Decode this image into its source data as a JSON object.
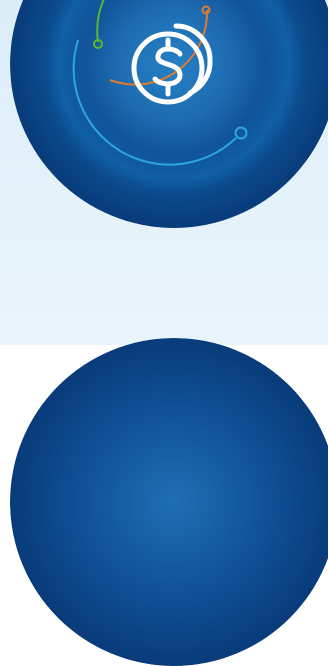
{
  "colors": {
    "background_top": "#dcedf8",
    "background_bottom": "#eaf5fb",
    "badge_center": "#1f6fb3",
    "badge_mid": "#0f4f95",
    "badge_edge": "#083b79",
    "ring_green": "#5cb82e",
    "ring_orange": "#e07a2f",
    "ring_blue": "#2aa7e0",
    "icon_white": "#ffffff"
  },
  "icons": {
    "main": "dollar-coins-icon"
  }
}
